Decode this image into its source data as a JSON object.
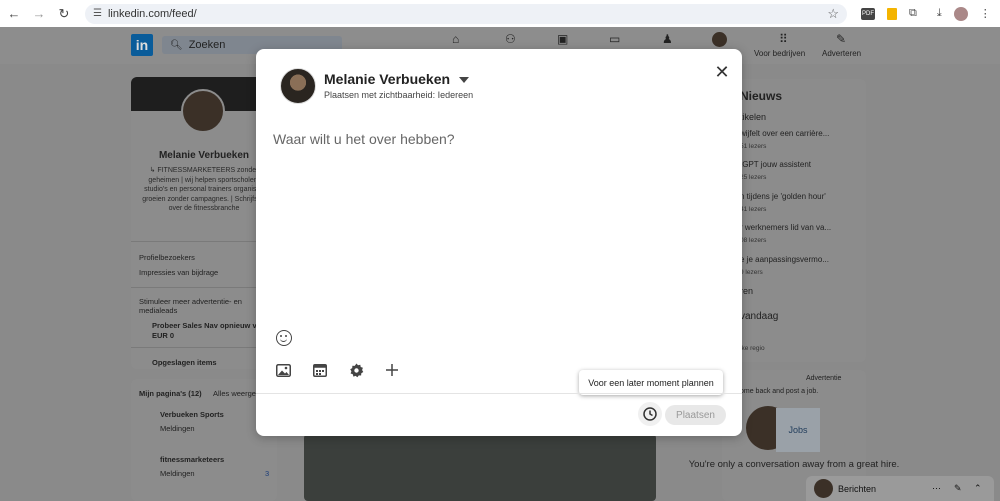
{
  "browser": {
    "url": "linkedin.com/feed/"
  },
  "linkedin": {
    "logo": "in",
    "search_placeholder": "Zoeken",
    "nav": {
      "business_label": "Voor bedrijven",
      "advertise_label": "Adverteren"
    },
    "profile": {
      "name": "Melanie Verbueken",
      "headline": "↳ FITNESSMARKETEERS zonder geheimen | wij helpen sportscholen, studio's en personal trainers organisch groeien zonder campagnes. | Schrijfster over de fitnessbranche",
      "profile_visitors": "Profielbezoekers",
      "post_impressions": "Impressies van bijdrage",
      "promo_line": "Stimuleer meer advertentie- en medialeads",
      "promo_offer": "Probeer Sales Nav opnieuw voor",
      "promo_price": "EUR 0",
      "saved_items": "Opgeslagen items"
    },
    "pages": {
      "title": "Mijn pagina's (12)",
      "see_all": "Alles weergeven",
      "items": [
        {
          "name": "Verbueken Sports",
          "sub": "Meldingen",
          "count": ""
        },
        {
          "name": "fitnessmarketeers",
          "sub": "Meldingen",
          "count": "3"
        }
      ]
    },
    "news": {
      "title": "Nieuws",
      "subtitle": "tikelen",
      "items": [
        {
          "title": "wijfelt over een carrière...",
          "meta": "51 lezers"
        },
        {
          "title": "tGPT jouw assistent",
          "meta": "25 lezers"
        },
        {
          "title": "n tijdens je 'golden hour'",
          "meta": "41 lezers"
        },
        {
          "title": "r werknemers lid van va...",
          "meta": "08 lezers"
        },
        {
          "title": "e je aanpassingsvermo...",
          "meta": "9 lezers"
        }
      ],
      "more": "ren",
      "today": "vandaag",
      "region": "lke regio"
    },
    "ad": {
      "label": "Advertentie",
      "line1": "ome back and post a job.",
      "jobs": "Jobs",
      "line2": "You're only a conversation away from a great hire."
    },
    "messaging": {
      "label": "Berichten"
    }
  },
  "modal": {
    "author_name": "Melanie Verbueken",
    "visibility": "Plaatsen met zichtbaarheid: Iedereen",
    "placeholder": "Waar wilt u het over hebben?",
    "tooltip": "Voor een later moment plannen",
    "post_label": "Plaatsen"
  }
}
